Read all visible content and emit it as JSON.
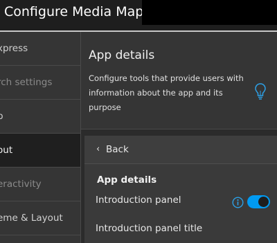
{
  "window": {
    "title": "Configure Media Map:"
  },
  "sidebar": {
    "items": [
      {
        "label": "xpress"
      },
      {
        "label": "rch settings"
      },
      {
        "label": "p"
      },
      {
        "label": "out"
      },
      {
        "label": "eractivity"
      },
      {
        "label": "eme & Layout"
      }
    ],
    "active_index": 3
  },
  "header": {
    "title": "App details",
    "description": "Configure tools that provide users with information about the app and its purpose",
    "tip_icon": "lightbulb-icon",
    "accent_color": "#009af2"
  },
  "panel": {
    "back_label": "Back",
    "section_title": "App details",
    "rows": [
      {
        "label": "Introduction panel",
        "toggle_on": true
      },
      {
        "label": "Introduction panel title"
      }
    ]
  }
}
